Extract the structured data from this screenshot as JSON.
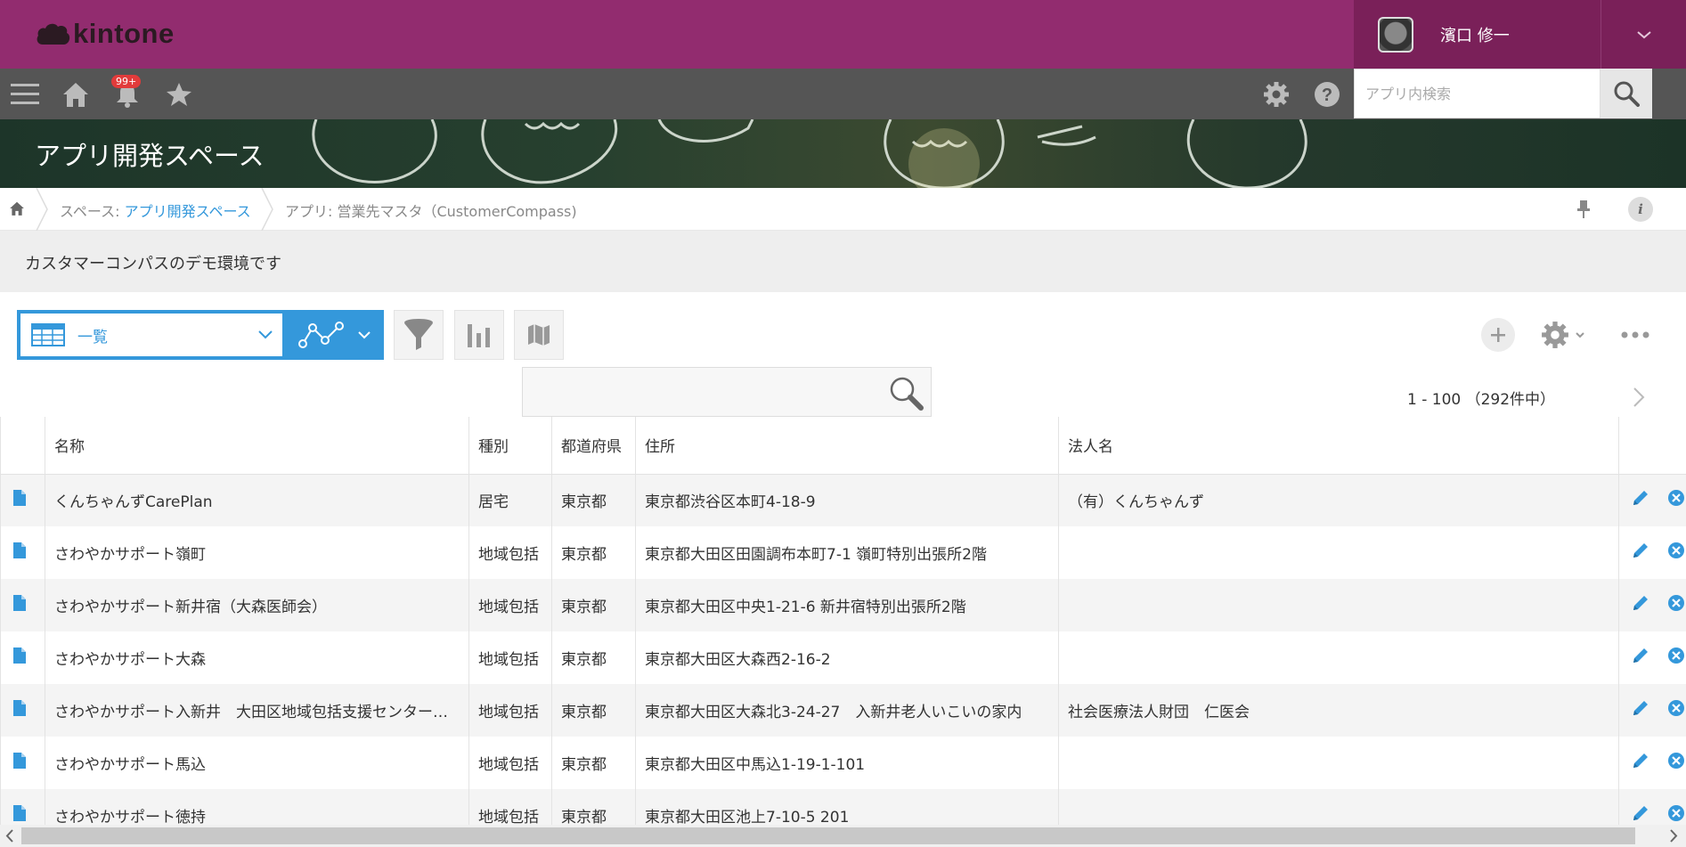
{
  "header": {
    "logo_text": "kintone",
    "user_name": "濱口 修一"
  },
  "nav": {
    "notification_count": "99+",
    "search_placeholder": "アプリ内検索"
  },
  "banner": {
    "title": "アプリ開発スペース"
  },
  "breadcrumb": {
    "space_prefix": "スペース: ",
    "space_name": "アプリ開発スペース",
    "app_label": "アプリ: 営業先マスタ（CustomerCompass)"
  },
  "description": "カスタマーコンパスのデモ環境です",
  "toolbar": {
    "view_name": "一覧",
    "keyword_value": ""
  },
  "pager": {
    "text": "1 - 100 （292件中）"
  },
  "table": {
    "headers": [
      "名称",
      "種別",
      "都道府県",
      "住所",
      "法人名"
    ],
    "rows": [
      [
        "くんちゃんずCarePlan",
        "居宅",
        "東京都",
        "東京都渋谷区本町4-18-9",
        "（有）くんちゃんず"
      ],
      [
        "さわやかサポート嶺町",
        "地域包括",
        "東京都",
        "東京都大田区田園調布本町7-1 嶺町特別出張所2階",
        ""
      ],
      [
        "さわやかサポート新井宿（大森医師会）",
        "地域包括",
        "東京都",
        "東京都大田区中央1-21-6 新井宿特別出張所2階",
        ""
      ],
      [
        "さわやかサポート大森",
        "地域包括",
        "東京都",
        "東京都大田区大森西2-16-2",
        ""
      ],
      [
        "さわやかサポート入新井　大田区地域包括支援センター…",
        "地域包括",
        "東京都",
        "東京都大田区大森北3-24-27　入新井老人いこいの家内",
        "社会医療法人財団　仁医会"
      ],
      [
        "さわやかサポート馬込",
        "地域包括",
        "東京都",
        "東京都大田区中馬込1-19-1-101",
        ""
      ],
      [
        "さわやかサポート徳持",
        "地域包括",
        "東京都",
        "東京都大田区池上7-10-5 201",
        ""
      ]
    ]
  },
  "colors": {
    "topbar": "#922c6f",
    "navbar": "#555555",
    "accent": "#3498db"
  }
}
